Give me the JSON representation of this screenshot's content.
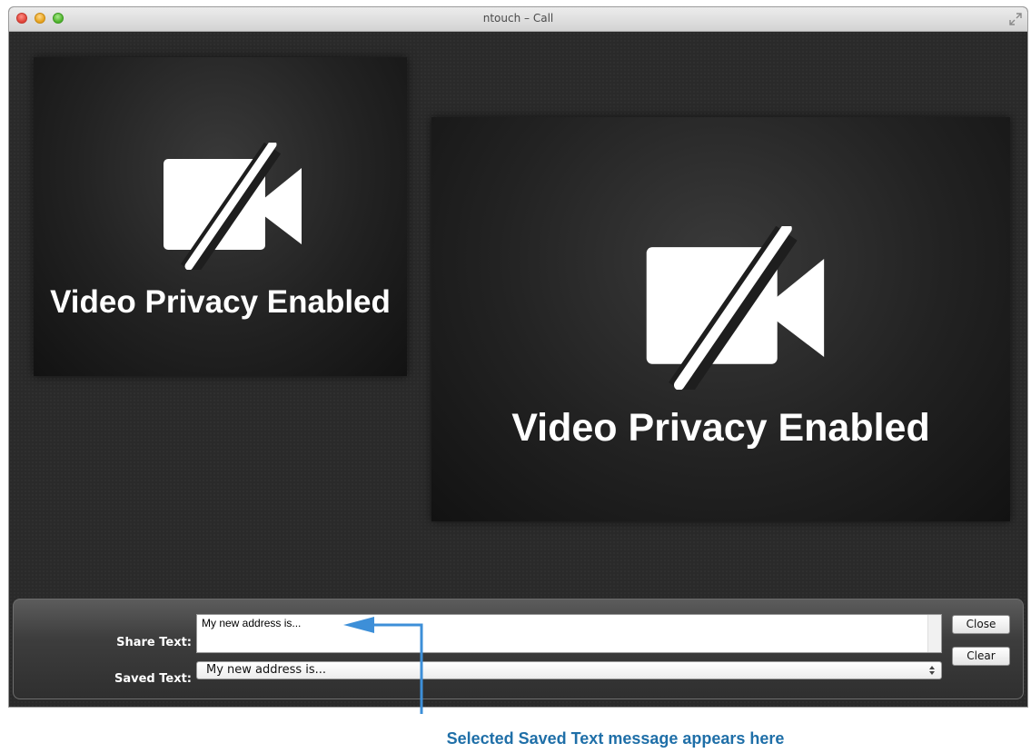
{
  "window": {
    "title": "ntouch – Call"
  },
  "video": {
    "self_status": "Video Privacy Enabled",
    "remote_status": "Video Privacy Enabled"
  },
  "share_panel": {
    "share_label": "Share Text:",
    "share_value": "My new address is...",
    "saved_label": "Saved Text:",
    "saved_selected": "My new address is...",
    "close_label": "Close",
    "clear_label": "Clear"
  },
  "annotation": {
    "text": "Selected Saved Text message appears here"
  },
  "colors": {
    "annotation": "#1f6fa8",
    "arrow": "#3d8fd8",
    "background": "#2a2a2a"
  },
  "icons": [
    "close-window-icon",
    "minimize-window-icon",
    "maximize-window-icon",
    "fullscreen-icon",
    "video-off-icon",
    "select-arrows-icon"
  ]
}
